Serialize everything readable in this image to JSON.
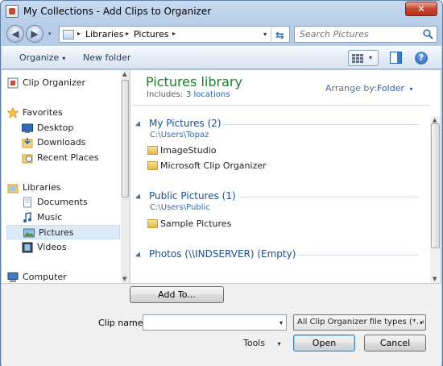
{
  "window": {
    "title": "My Collections - Add Clips to Organizer",
    "close_label": "✕"
  },
  "address": {
    "crumbs": [
      "Libraries",
      "Pictures"
    ],
    "separator": "▸",
    "dropdown": "▾",
    "refresh": "⇆"
  },
  "search": {
    "placeholder": "Search Pictures"
  },
  "toolbar": {
    "organize_label": "Organize",
    "new_folder_label": "New folder",
    "caret": "▾",
    "help": "?"
  },
  "navigation": {
    "items": [
      {
        "label": "Clip Organizer",
        "icon": "clip-organizer-icon"
      },
      {
        "label": "Favorites",
        "icon": "star-icon"
      },
      {
        "label": "Desktop",
        "icon": "desktop-icon"
      },
      {
        "label": "Downloads",
        "icon": "downloads-icon"
      },
      {
        "label": "Recent Places",
        "icon": "recent-places-icon"
      },
      {
        "label": "Libraries",
        "icon": "libraries-icon"
      },
      {
        "label": "Documents",
        "icon": "documents-icon"
      },
      {
        "label": "Music",
        "icon": "music-icon"
      },
      {
        "label": "Pictures",
        "icon": "pictures-icon",
        "selected": true
      },
      {
        "label": "Videos",
        "icon": "videos-icon"
      },
      {
        "label": "Computer",
        "icon": "computer-icon"
      }
    ]
  },
  "content": {
    "library_title": "Pictures library",
    "includes_label": "Includes:",
    "includes_link": "3 locations",
    "arrange_label": "Arrange by:",
    "arrange_value": "Folder",
    "arrange_caret": "▾",
    "groups": [
      {
        "title": "My Pictures (2)",
        "path": "C:\\Users\\Topaz",
        "files": [
          "ImageStudio",
          "Microsoft Clip Organizer"
        ]
      },
      {
        "title": "Public Pictures (1)",
        "path": "C:\\Users\\Public",
        "files": [
          "Sample Pictures"
        ]
      },
      {
        "title": "Photos (\\\\INDSERVER) (Empty)",
        "path": "",
        "files": []
      }
    ]
  },
  "bottom": {
    "add_to_label": "Add To...",
    "clip_name_label": "Clip name:",
    "clip_name_value": "",
    "file_type_value": "All Clip Organizer file types (*.p",
    "tools_label": "Tools",
    "open_label": "Open",
    "cancel_label": "Cancel",
    "caret": "▾"
  }
}
